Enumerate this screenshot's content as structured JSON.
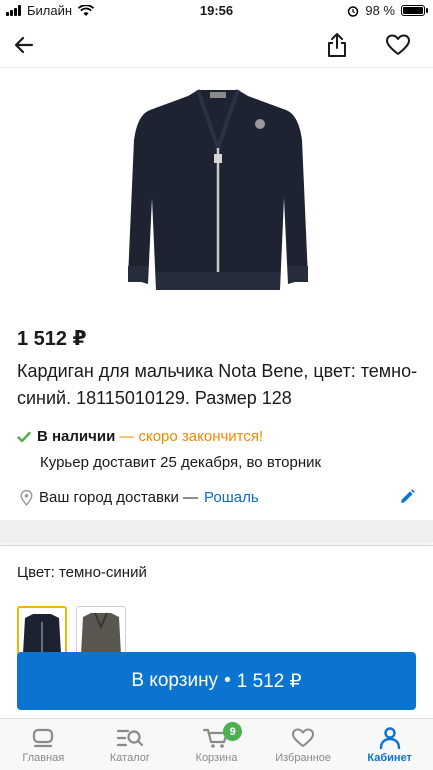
{
  "status_bar": {
    "carrier": "Билайн",
    "time": "19:56",
    "battery": "98 %",
    "battery_level": 0.98
  },
  "header": {
    "back_icon": "arrow-left-icon",
    "share_icon": "share-icon",
    "favorite_icon": "heart-icon"
  },
  "product": {
    "price": "1 512 ₽",
    "title": "Кардиган для мальчика Nota Bene, цвет: темно-синий. 18115010129. Размер 128",
    "stock_status": "В наличии",
    "stock_warning": "— скоро закончится!",
    "courier": "Курьер доставит 25 декабря, во вторник",
    "city_label": "Ваш город доставки —",
    "city": "Рошаль"
  },
  "colors": {
    "label": "Цвет: темно-синий",
    "swatches": [
      {
        "name": "темно-синий",
        "hex": "#1c2230",
        "selected": true
      },
      {
        "name": "серый",
        "hex": "#5a5650",
        "selected": false
      }
    ]
  },
  "cart_button": {
    "label": "В корзину",
    "separator": "•",
    "price": "1 512 ₽"
  },
  "nav": {
    "items": [
      {
        "label": "Главная",
        "icon": "home-icon"
      },
      {
        "label": "Каталог",
        "icon": "catalog-search-icon"
      },
      {
        "label": "Корзина",
        "icon": "cart-icon",
        "badge": "9"
      },
      {
        "label": "Избранное",
        "icon": "heart-icon"
      },
      {
        "label": "Кабинет",
        "icon": "user-icon",
        "active": true
      }
    ]
  },
  "colors_ui": {
    "accent": "#0a74d0",
    "warning": "#f08a00",
    "success": "#4caf50",
    "selected_border": "#f5b400"
  }
}
